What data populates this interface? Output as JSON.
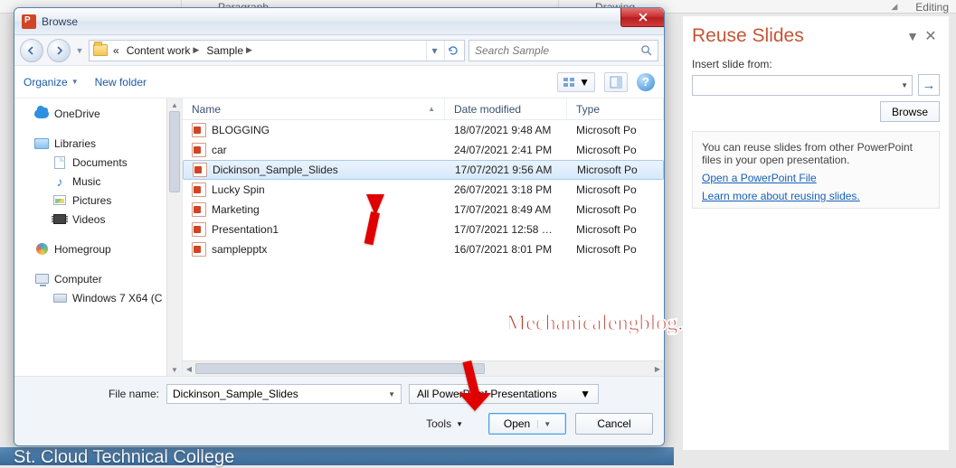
{
  "ribbon": {
    "paragraph": "Paragraph",
    "drawing": "Drawing",
    "editing": "Editing"
  },
  "bg_slide_text": "St. Cloud Technical College",
  "dialog": {
    "title": "Browse",
    "breadcrumb": {
      "prefix": "«",
      "a": "Content work",
      "b": "Sample"
    },
    "search_placeholder": "Search Sample",
    "organize": "Organize",
    "new_folder": "New folder",
    "tree": {
      "onedrive": "OneDrive",
      "libraries": "Libraries",
      "documents": "Documents",
      "music": "Music",
      "pictures": "Pictures",
      "videos": "Videos",
      "homegroup": "Homegroup",
      "computer": "Computer",
      "drive": "Windows 7 X64 (C"
    },
    "columns": {
      "name": "Name",
      "date": "Date modified",
      "type": "Type"
    },
    "files": [
      {
        "name": "BLOGGING",
        "date": "18/07/2021 9:48 AM",
        "type": "Microsoft Po"
      },
      {
        "name": "car",
        "date": "24/07/2021 2:41 PM",
        "type": "Microsoft Po"
      },
      {
        "name": "Dickinson_Sample_Slides",
        "date": "17/07/2021 9:56 AM",
        "type": "Microsoft Po",
        "selected": true
      },
      {
        "name": "Lucky Spin",
        "date": "26/07/2021 3:18 PM",
        "type": "Microsoft Po"
      },
      {
        "name": "Marketing",
        "date": "17/07/2021 8:49 AM",
        "type": "Microsoft Po"
      },
      {
        "name": "Presentation1",
        "date": "17/07/2021 12:58 …",
        "type": "Microsoft Po"
      },
      {
        "name": "samplepptx",
        "date": "16/07/2021 8:01 PM",
        "type": "Microsoft Po"
      }
    ],
    "filename_label": "File name:",
    "filename_value": "Dickinson_Sample_Slides",
    "filter": "All PowerPoint Presentations",
    "tools": "Tools",
    "open": "Open",
    "cancel": "Cancel"
  },
  "reuse": {
    "title": "Reuse Slides",
    "insert_from": "Insert slide from:",
    "browse": "Browse",
    "info": "You can reuse slides from other PowerPoint files in your open presentation.",
    "link_open": "Open a PowerPoint File",
    "link_learn": "Learn more about reusing slides."
  },
  "watermark": "Mechanicalengblog.com"
}
